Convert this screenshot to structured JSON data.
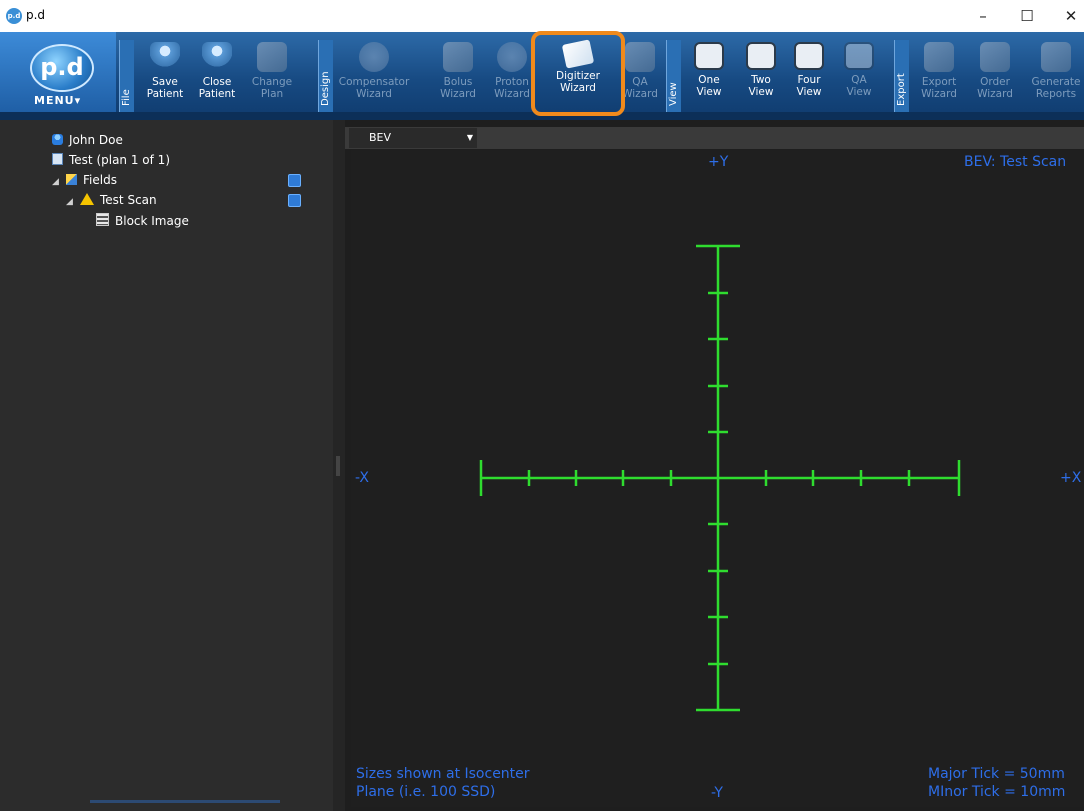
{
  "window": {
    "title": "p.d",
    "icon": "pd-app-icon"
  },
  "ribbon": {
    "menu_label": "MENU▾",
    "logo_text": "p.d",
    "groups": [
      {
        "label": "File",
        "buttons": [
          {
            "label": "Save\nPatient",
            "enabled": true,
            "icon": "save-patient-icon"
          },
          {
            "label": "Close\nPatient",
            "enabled": true,
            "icon": "close-patient-icon"
          },
          {
            "label": "Change\nPlan",
            "enabled": false,
            "icon": "change-plan-icon"
          }
        ]
      },
      {
        "label": "Design",
        "buttons": [
          {
            "label": "Compensator\nWizard",
            "enabled": false,
            "icon": "compensator-icon"
          },
          {
            "label": "Bolus\nWizard",
            "enabled": false,
            "icon": "bolus-icon"
          },
          {
            "label": "Proton\nWizard",
            "enabled": false,
            "icon": "proton-icon"
          },
          {
            "label": "Digitizer\nWizard",
            "enabled": true,
            "highlighted": true,
            "icon": "digitizer-icon"
          },
          {
            "label": "QA\nWizard",
            "enabled": false,
            "icon": "qa-wizard-icon"
          }
        ]
      },
      {
        "label": "View",
        "buttons": [
          {
            "label": "One\nView",
            "enabled": true,
            "icon": "one-view-icon"
          },
          {
            "label": "Two\nView",
            "enabled": true,
            "icon": "two-view-icon"
          },
          {
            "label": "Four\nView",
            "enabled": true,
            "icon": "four-view-icon"
          },
          {
            "label": "QA\nView",
            "enabled": false,
            "icon": "qa-view-icon"
          }
        ]
      },
      {
        "label": "Export",
        "buttons": [
          {
            "label": "Export\nWizard",
            "enabled": false,
            "icon": "export-icon"
          },
          {
            "label": "Order\nWizard",
            "enabled": false,
            "icon": "order-icon"
          },
          {
            "label": "Generate\nReports",
            "enabled": false,
            "icon": "reports-icon"
          }
        ]
      }
    ],
    "highlight_color": "#f08a1c"
  },
  "tree": {
    "patient": "John Doe",
    "plan": "Test (plan 1 of 1)",
    "fields": "Fields",
    "scan": "Test Scan",
    "block": "Block Image"
  },
  "viewer": {
    "tab_label": "BEV",
    "title": "BEV: Test Scan",
    "axis": {
      "pos_y": "+Y",
      "neg_y": "-Y",
      "pos_x": "+X",
      "neg_x": "-X"
    },
    "footer_left_1": "Sizes shown at Isocenter",
    "footer_left_2": "Plane (i.e. 100 SSD)",
    "footer_right_1": "Major Tick = 50mm",
    "footer_right_2": "MInor Tick = 10mm",
    "crosshair_color": "#2fdc2f",
    "label_color": "#2e6ee8"
  }
}
